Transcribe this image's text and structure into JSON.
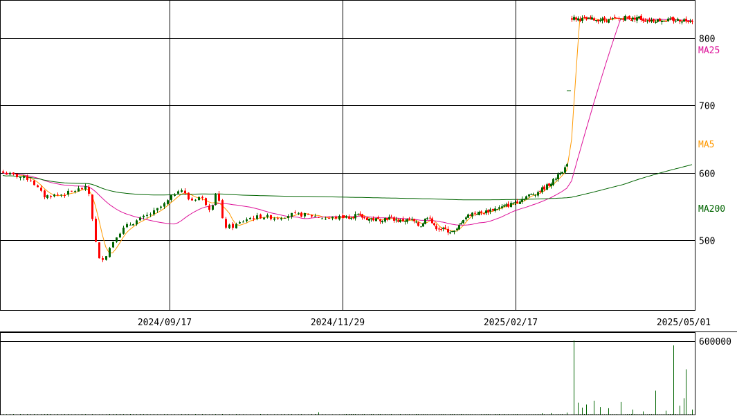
{
  "chart_data": {
    "type": "candlestick",
    "price_axis": {
      "ylim": [
        450,
        855
      ],
      "ticks": [
        500,
        600,
        700,
        800
      ],
      "tick_labels": [
        "500",
        "600",
        "700",
        "800"
      ]
    },
    "date_axis": {
      "tick_labels": [
        "2024/09/17",
        "2024/11/29",
        "2025/02/17",
        "2025/05/01"
      ]
    },
    "volume_axis": {
      "ylim": [
        0,
        600000
      ],
      "tick_labels": [
        "600000"
      ]
    },
    "legend": {
      "ma5_label": "MA5",
      "ma25_label": "MA25",
      "ma200_label": "MA200"
    },
    "colors": {
      "up": "#006400",
      "down": "#ff0000",
      "ma5": "#ff9900",
      "ma25": "#dd1199",
      "ma200": "#006400",
      "grid": "#000000",
      "volume": "#006400"
    },
    "segments": [
      {
        "n": 100,
        "anchors": [
          [
            0,
            600
          ],
          [
            8,
            590
          ],
          [
            12,
            565
          ],
          [
            18,
            568
          ],
          [
            22,
            575
          ],
          [
            25,
            578
          ],
          [
            28,
            470
          ],
          [
            30,
            475
          ],
          [
            33,
            505
          ],
          [
            36,
            520
          ],
          [
            40,
            530
          ],
          [
            44,
            540
          ],
          [
            48,
            555
          ],
          [
            52,
            578
          ],
          [
            55,
            558
          ],
          [
            58,
            565
          ],
          [
            61,
            545
          ],
          [
            63,
            575
          ],
          [
            65,
            520
          ],
          [
            68,
            520
          ],
          [
            72,
            532
          ],
          [
            76,
            535
          ],
          [
            80,
            533
          ],
          [
            85,
            538
          ],
          [
            90,
            537
          ],
          [
            95,
            532
          ],
          [
            100,
            534
          ]
        ]
      },
      {
        "n": 100,
        "anchors": [
          [
            0,
            533
          ],
          [
            5,
            537
          ],
          [
            10,
            532
          ],
          [
            15,
            530
          ],
          [
            20,
            533
          ],
          [
            25,
            528
          ],
          [
            30,
            530
          ],
          [
            34,
            520
          ],
          [
            38,
            538
          ],
          [
            40,
            520
          ],
          [
            45,
            515
          ],
          [
            48,
            512
          ],
          [
            50,
            512
          ],
          [
            53,
            530
          ],
          [
            57,
            540
          ],
          [
            62,
            540
          ],
          [
            66,
            545
          ],
          [
            70,
            548
          ],
          [
            74,
            552
          ],
          [
            78,
            558
          ],
          [
            82,
            565
          ],
          [
            86,
            570
          ],
          [
            90,
            578
          ],
          [
            94,
            588
          ],
          [
            96,
            598
          ],
          [
            100,
            610
          ]
        ]
      },
      {
        "n": 60,
        "anchors": [
          [
            0,
            830
          ],
          [
            10,
            828
          ],
          [
            20,
            828
          ],
          [
            30,
            827
          ],
          [
            40,
            829
          ],
          [
            45,
            832
          ],
          [
            50,
            828
          ],
          [
            55,
            832
          ],
          [
            58,
            828
          ],
          [
            60,
            827
          ]
        ]
      }
    ],
    "annotation_tick": 722,
    "ma200_anchor": 590,
    "volume_spikes": [
      {
        "seg": 0,
        "pos": 92,
        "v": 18000
      },
      {
        "seg": 1,
        "pos": 88,
        "v": 10000
      },
      {
        "seg": 1,
        "pos": 92,
        "v": 12000
      },
      {
        "seg": 1,
        "pos": 99,
        "v": 15000
      },
      {
        "seg": 2,
        "pos": 1,
        "v": 590000
      },
      {
        "seg": 2,
        "pos": 3,
        "v": 95000
      },
      {
        "seg": 2,
        "pos": 5,
        "v": 55000
      },
      {
        "seg": 2,
        "pos": 7,
        "v": 80000
      },
      {
        "seg": 2,
        "pos": 11,
        "v": 110000
      },
      {
        "seg": 2,
        "pos": 14,
        "v": 60000
      },
      {
        "seg": 2,
        "pos": 18,
        "v": 50000
      },
      {
        "seg": 2,
        "pos": 24,
        "v": 100000
      },
      {
        "seg": 2,
        "pos": 30,
        "v": 40000
      },
      {
        "seg": 2,
        "pos": 35,
        "v": 25000
      },
      {
        "seg": 2,
        "pos": 41,
        "v": 190000
      },
      {
        "seg": 2,
        "pos": 46,
        "v": 30000
      },
      {
        "seg": 2,
        "pos": 50,
        "v": 550000
      },
      {
        "seg": 2,
        "pos": 53,
        "v": 70000
      },
      {
        "seg": 2,
        "pos": 55,
        "v": 130000
      },
      {
        "seg": 2,
        "pos": 56,
        "v": 360000
      },
      {
        "seg": 2,
        "pos": 59,
        "v": 40000
      }
    ]
  }
}
